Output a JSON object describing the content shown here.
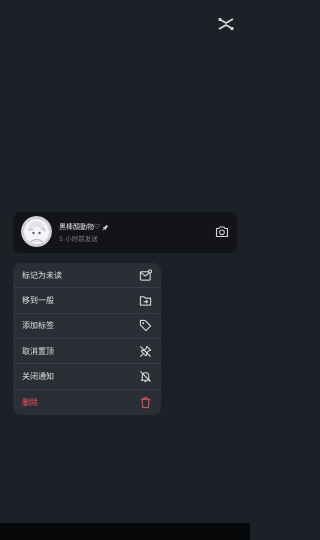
{
  "chat": {
    "name": "黑棒顏動物♡",
    "subtitle": "5 小时前发送"
  },
  "icons": {
    "top_logo": "capcut-logo-icon",
    "pin": "pin-icon",
    "camera": "camera-icon"
  },
  "menu": {
    "items": [
      {
        "label": "标记为未读",
        "icon": "mark-unread-icon"
      },
      {
        "label": "移到一般",
        "icon": "move-folder-icon"
      },
      {
        "label": "添加标签",
        "icon": "tag-icon"
      },
      {
        "label": "取消置顶",
        "icon": "unpin-icon"
      },
      {
        "label": "关闭通知",
        "icon": "bell-off-icon"
      },
      {
        "label": "删除",
        "icon": "trash-icon"
      }
    ]
  },
  "colors": {
    "background": "#1d2026",
    "menu_bg": "#2b2e35",
    "card_bg": "#121418",
    "danger": "#f2545b"
  }
}
